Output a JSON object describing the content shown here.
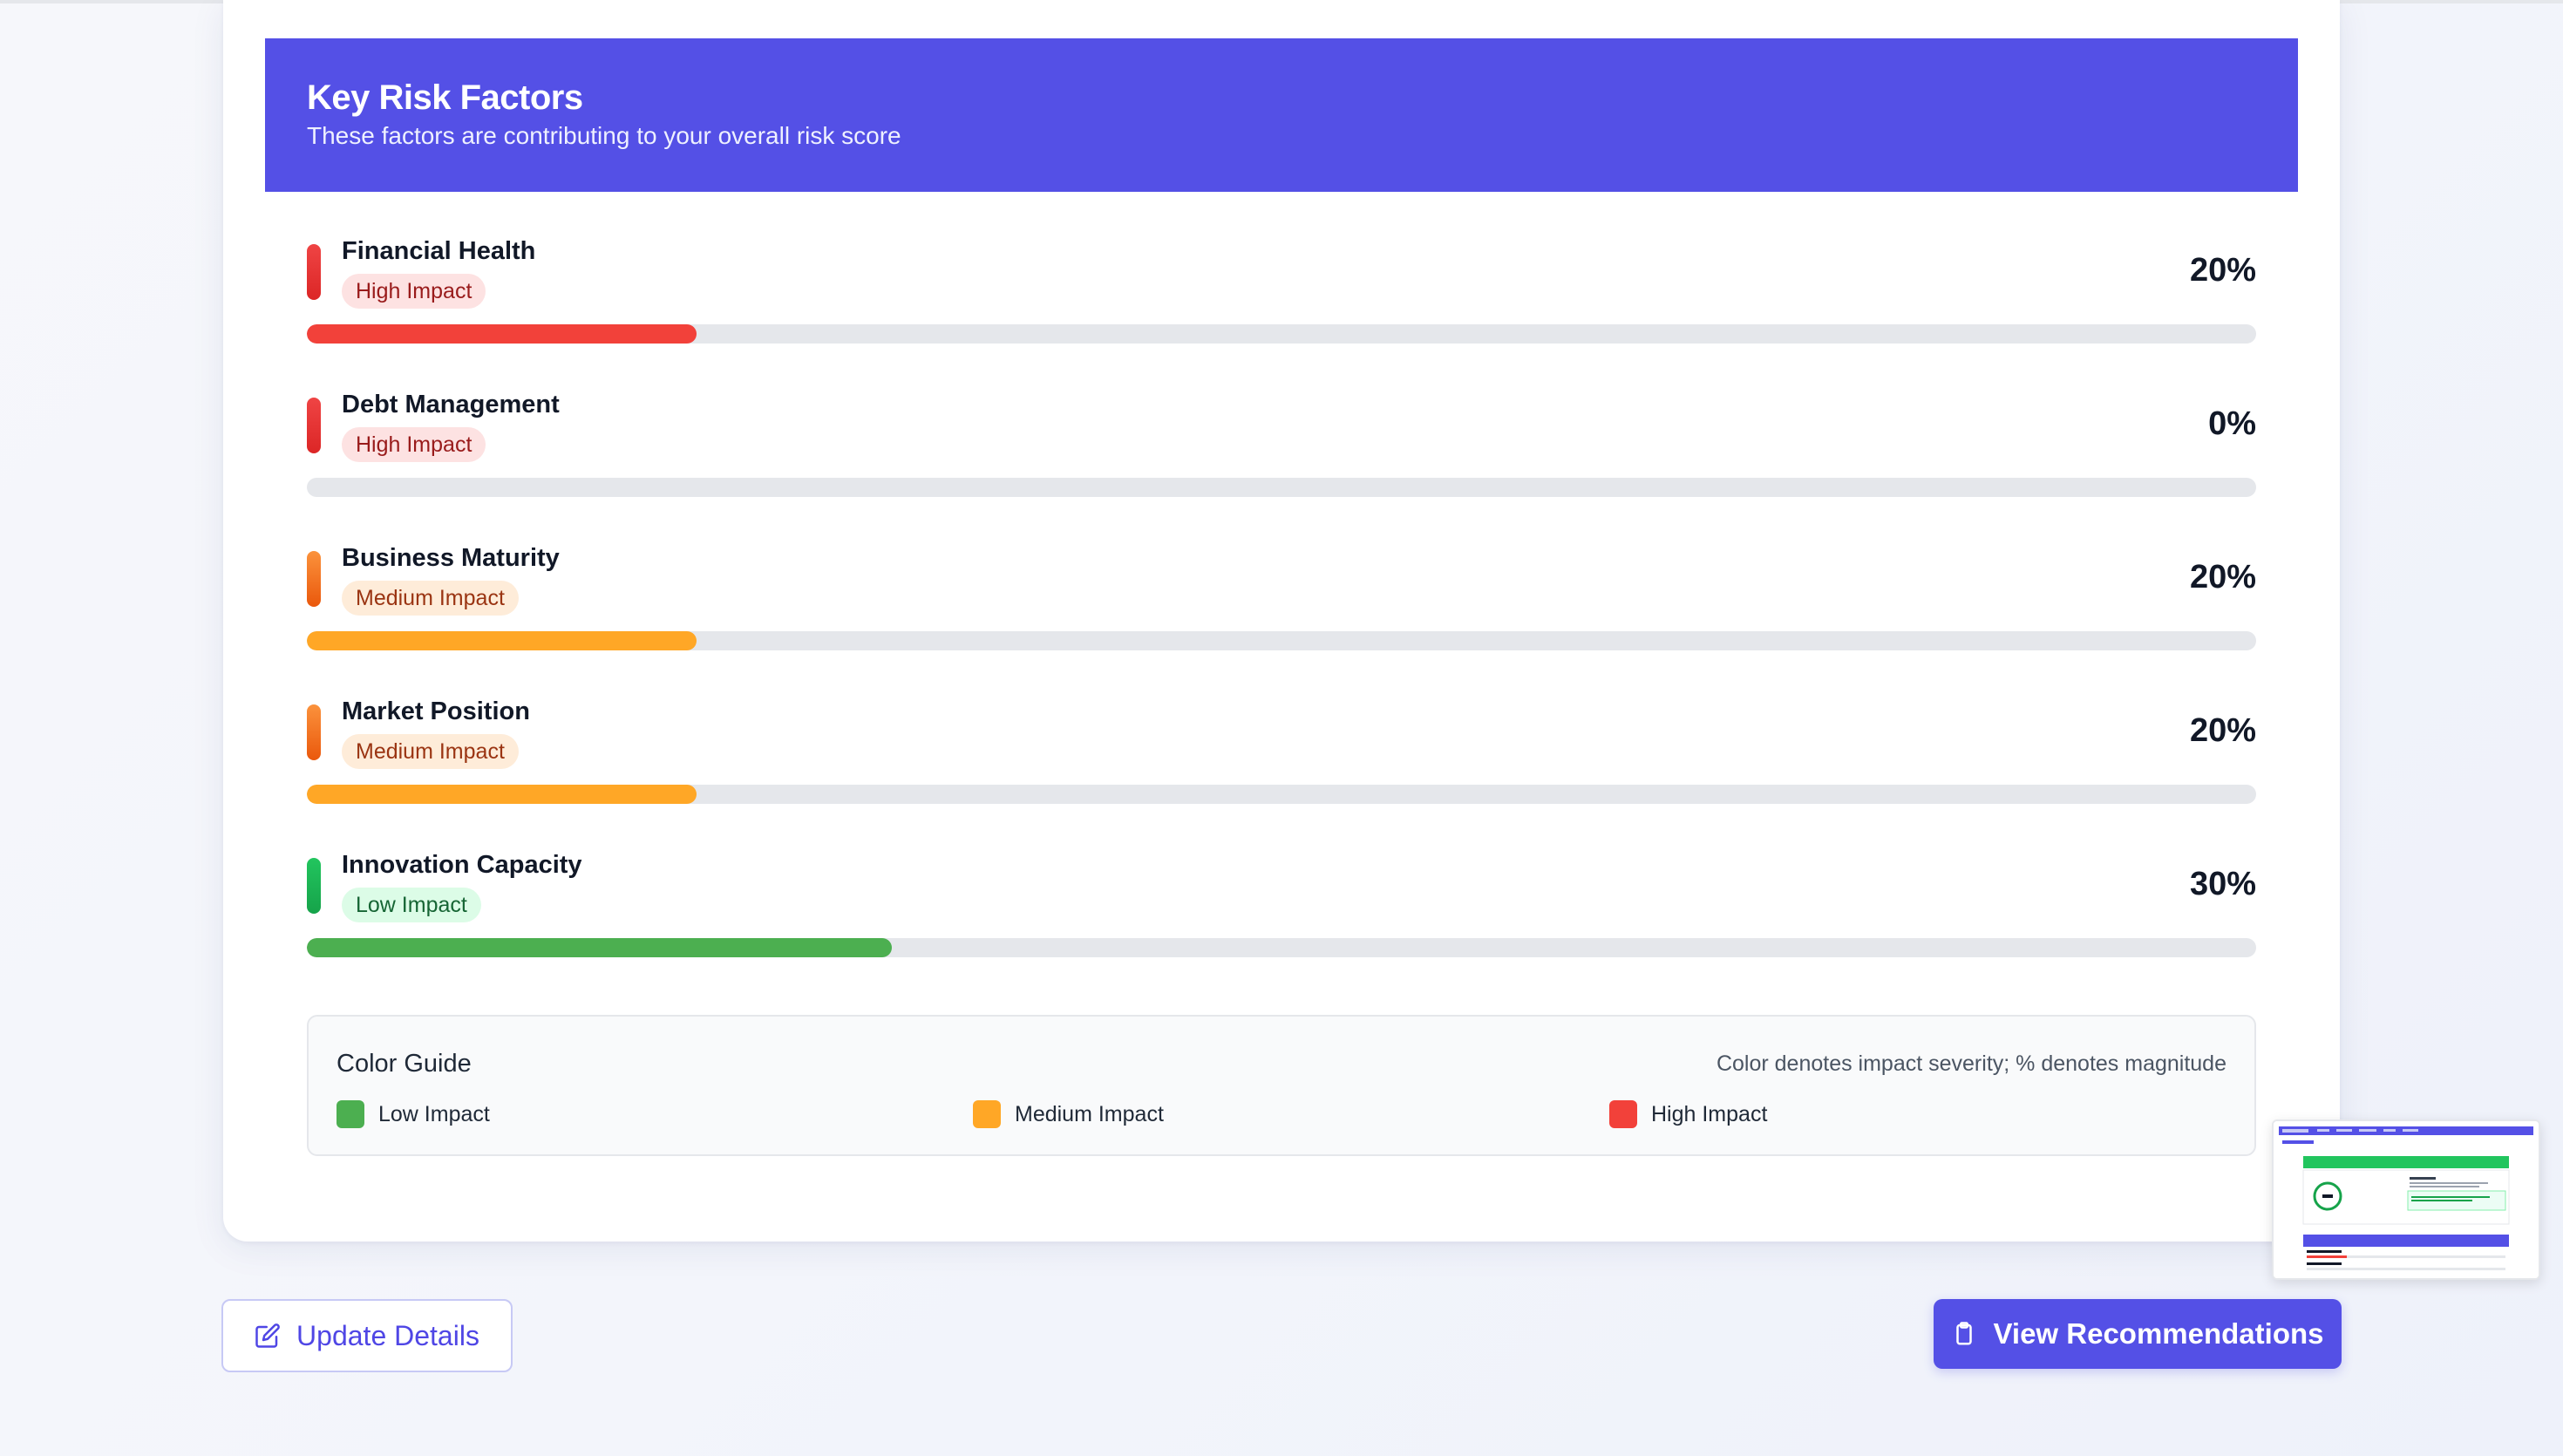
{
  "risk_factors": {
    "title": "Key Risk Factors",
    "subtitle": "These factors are contributing to your overall risk score",
    "items": [
      {
        "name": "Financial Health",
        "impact": "High Impact",
        "level": "high",
        "percent_label": "20%",
        "percent": 20
      },
      {
        "name": "Debt Management",
        "impact": "High Impact",
        "level": "high",
        "percent_label": "0%",
        "percent": 0
      },
      {
        "name": "Business Maturity",
        "impact": "Medium Impact",
        "level": "medium",
        "percent_label": "20%",
        "percent": 20
      },
      {
        "name": "Market Position",
        "impact": "Medium Impact",
        "level": "medium",
        "percent_label": "20%",
        "percent": 20
      },
      {
        "name": "Innovation Capacity",
        "impact": "Low Impact",
        "level": "low",
        "percent_label": "30%",
        "percent": 30
      }
    ]
  },
  "color_guide": {
    "title": "Color Guide",
    "note": "Color denotes impact severity; % denotes magnitude",
    "low_label": "Low Impact",
    "medium_label": "Medium Impact",
    "high_label": "High Impact",
    "low_color": "#4caf50",
    "medium_color": "#ffa726",
    "high_color": "#f2413a"
  },
  "actions": {
    "update_label": "Update Details",
    "update_icon": "edit-icon",
    "recommendations_label": "View Recommendations",
    "recommendations_icon": "clipboard-icon"
  },
  "theme": {
    "accent": "#5450e6"
  }
}
